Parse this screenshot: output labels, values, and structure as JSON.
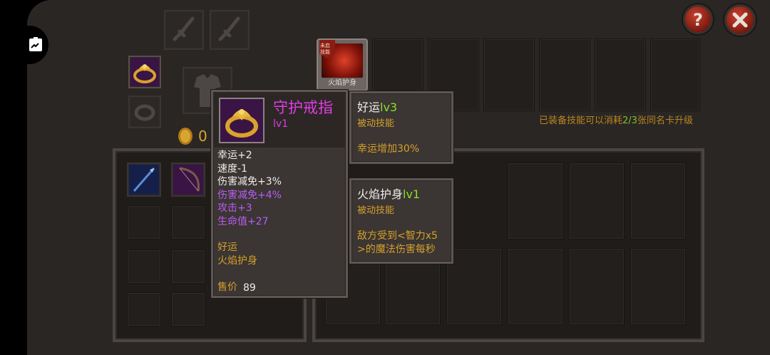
{
  "currency": {
    "amount": "0"
  },
  "skill_card": {
    "badge": "未启\n技能",
    "label": "火焰护身"
  },
  "upgrade_hint": {
    "prefix": "已装备技能可以消耗",
    "ratio": "2/3",
    "suffix": "张同名卡升级"
  },
  "item_tooltip": {
    "name": "守护戒指",
    "level": "lv1",
    "stats": [
      {
        "text": "幸运+2",
        "color": "#f0ede8"
      },
      {
        "text": "速度-1",
        "color": "#f0ede8"
      },
      {
        "text": "伤害减免+3%",
        "color": "#f0ede8"
      },
      {
        "text": "伤害减免+4%",
        "color": "#b95cf5"
      },
      {
        "text": "攻击+3",
        "color": "#b95cf5"
      },
      {
        "text": "生命值+27",
        "color": "#b95cf5"
      }
    ],
    "skills": [
      "好运",
      "火焰护身"
    ],
    "price_label": "售价",
    "price_value": "89"
  },
  "skill_tooltips": [
    {
      "name": "好运",
      "level": "lv3",
      "type": "被动技能",
      "desc_lines": [
        "幸运增加30%"
      ]
    },
    {
      "name": "火焰护身",
      "level": "lv1",
      "type": "被动技能",
      "desc_lines": [
        "敌方受到<智力x5",
        ">的魔法伤害每秒"
      ]
    }
  ],
  "colors": {
    "name_magenta": "#e23ce6",
    "gold": "#d4a02a",
    "level_green": "#8be028",
    "purple_stat": "#b95cf5"
  },
  "icons": [
    "puzzle-icon",
    "help-icon",
    "close-icon",
    "sword-icon",
    "ring-icon",
    "armor-icon",
    "coin-icon",
    "spear-icon",
    "bow-icon"
  ]
}
